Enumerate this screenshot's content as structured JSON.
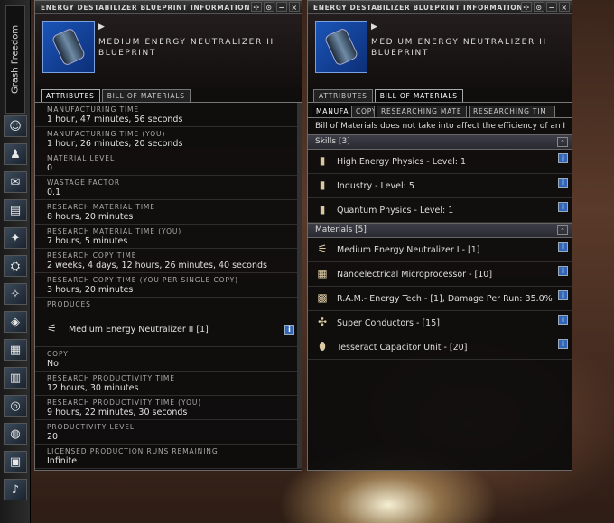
{
  "neocom": {
    "character_name": "Grash Freedom",
    "buttons": [
      {
        "icon": "character-icon",
        "glyph": "☺"
      },
      {
        "icon": "people-icon",
        "glyph": "♟"
      },
      {
        "icon": "mail-icon",
        "glyph": "✉"
      },
      {
        "icon": "notepad-icon",
        "glyph": "▤"
      },
      {
        "icon": "map-icon",
        "glyph": "✦"
      },
      {
        "icon": "corporation-icon",
        "glyph": "⛭"
      },
      {
        "icon": "starmap-icon",
        "glyph": "✧"
      },
      {
        "icon": "assets-icon",
        "glyph": "◈"
      },
      {
        "icon": "wallet-icon",
        "glyph": "▦"
      },
      {
        "icon": "calculator-icon",
        "glyph": "▥"
      },
      {
        "icon": "help-icon",
        "glyph": "◎"
      },
      {
        "icon": "browser-icon",
        "glyph": "◍"
      },
      {
        "icon": "journal-icon",
        "glyph": "▣"
      },
      {
        "icon": "tutorial-icon",
        "glyph": "♪"
      }
    ]
  },
  "left_window": {
    "title": "ENERGY DESTABILIZER BLUEPRINT INFORMATION",
    "item_name_line1": "MEDIUM ENERGY NEUTRALIZER II",
    "item_name_line2": "BLUEPRINT",
    "tabs": [
      "ATTRIBUTES",
      "BILL OF MATERIALS"
    ],
    "attributes": [
      {
        "label": "MANUFACTURING TIME",
        "value": "1 hour, 47 minutes, 56 seconds"
      },
      {
        "label": "MANUFACTURING TIME (YOU)",
        "value": "1 hour, 26 minutes, 20 seconds"
      },
      {
        "label": "MATERIAL LEVEL",
        "value": "0"
      },
      {
        "label": "WASTAGE FACTOR",
        "value": "0.1"
      },
      {
        "label": "RESEARCH MATERIAL TIME",
        "value": "8 hours, 20 minutes"
      },
      {
        "label": "RESEARCH MATERIAL TIME (YOU)",
        "value": "7 hours, 5 minutes"
      },
      {
        "label": "RESEARCH COPY TIME",
        "value": "2 weeks, 4 days, 12 hours, 26 minutes, 40 seconds"
      },
      {
        "label": "RESEARCH COPY TIME (YOU PER SINGLE COPY)",
        "value": "3 hours, 20 minutes"
      }
    ],
    "produces_label": "PRODUCES",
    "produces_item": "Medium Energy Neutralizer II [1]",
    "attributes2": [
      {
        "label": "COPY",
        "value": "No"
      },
      {
        "label": "RESEARCH PRODUCTIVITY TIME",
        "value": "12 hours, 30 minutes"
      },
      {
        "label": "RESEARCH PRODUCTIVITY TIME (YOU)",
        "value": "9 hours, 22 minutes, 30 seconds"
      },
      {
        "label": "PRODUCTIVITY LEVEL",
        "value": "20"
      },
      {
        "label": "LICENSED PRODUCTION RUNS REMAINING",
        "value": "Infinite"
      }
    ]
  },
  "right_window": {
    "title": "ENERGY DESTABILIZER BLUEPRINT INFORMATION",
    "item_name_line1": "MEDIUM ENERGY NEUTRALIZER II",
    "item_name_line2": "BLUEPRINT",
    "tabs": [
      "ATTRIBUTES",
      "BILL OF MATERIALS"
    ],
    "subtabs": [
      "MANUFA",
      "COPY",
      "RESEARCHING MATE",
      "RESEARCHING TIM"
    ],
    "note": "Bill of Materials does not take into affect the efficiency of an I",
    "skills_header": "Skills [3]",
    "skills": [
      "High Energy Physics - Level: 1",
      "Industry - Level: 5",
      "Quantum Physics - Level: 1"
    ],
    "materials_header": "Materials [5]",
    "materials": [
      "Medium Energy Neutralizer I - [1]",
      "Nanoelectrical Microprocessor - [10]",
      "R.A.M.- Energy Tech - [1], Damage Per Run: 35.0%",
      "Super Conductors - [15]",
      "Tesseract Capacitor Unit - [20]"
    ]
  },
  "window_buttons": [
    "✣",
    "⊙",
    "−",
    "×"
  ],
  "colors": {
    "info_button": "#3466b8",
    "icon_background": "#1a55b8"
  }
}
